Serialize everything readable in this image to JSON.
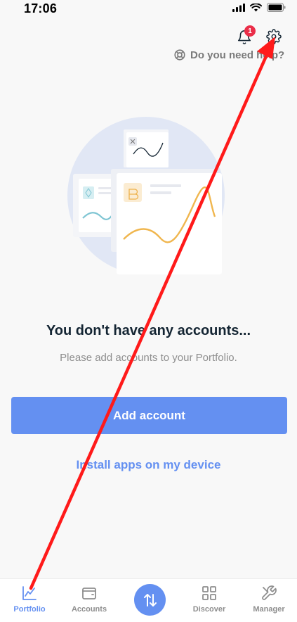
{
  "status_bar": {
    "time": "17:06",
    "icons": [
      "signal-icon",
      "wifi-icon",
      "battery-icon"
    ]
  },
  "header": {
    "notifications_badge": "1",
    "help_label": "Do you need help?",
    "icons": [
      "bell-icon",
      "gear-icon",
      "lifebuoy-icon"
    ]
  },
  "empty_state": {
    "title": "You don't have any accounts...",
    "subtitle": "Please add accounts to your Portfolio."
  },
  "actions": {
    "add_account_label": "Add account",
    "install_apps_label": "Install apps on my device"
  },
  "bottom_nav": {
    "items": [
      {
        "label": "Portfolio",
        "icon": "chart-line-icon",
        "active": true
      },
      {
        "label": "Accounts",
        "icon": "wallet-icon",
        "active": false
      },
      {
        "label": "",
        "icon": "transfer-icon",
        "active": false
      },
      {
        "label": "Discover",
        "icon": "grid-icon",
        "active": false
      },
      {
        "label": "Manager",
        "icon": "tools-icon",
        "active": false
      }
    ]
  },
  "colors": {
    "accent": "#6490f1",
    "badge": "#ea2e49",
    "annotation_arrow": "#ff1a1a",
    "background": "#f8f8f8"
  }
}
